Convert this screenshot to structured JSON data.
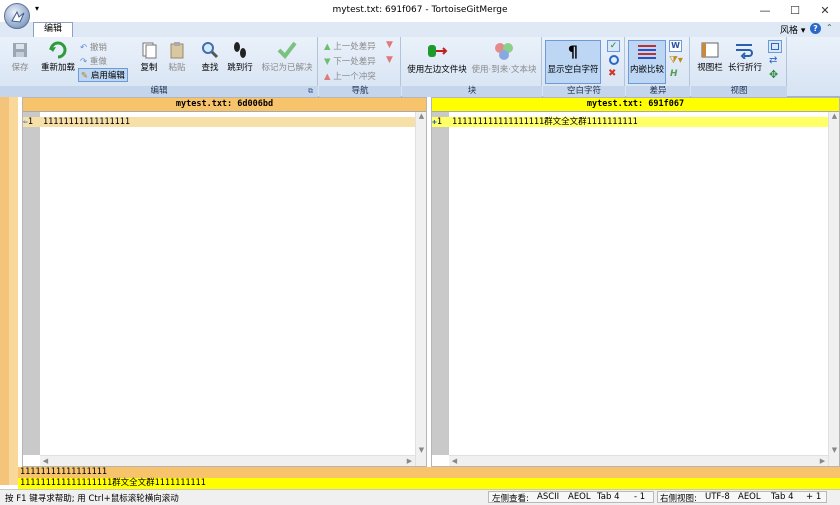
{
  "window": {
    "title": "mytest.txt: 691f067 - TortoiseGitMerge",
    "qat_glyph": "▾",
    "min": "—",
    "max": "☐",
    "close": "✕"
  },
  "ribbon": {
    "tabs": [
      {
        "label": "编辑"
      }
    ],
    "style_menu": "风格 ▾",
    "help": "?",
    "minimize_glyph": "⌃",
    "groups": {
      "edit": {
        "label": "编辑",
        "save": "保存",
        "reload": "重新加载",
        "undo": "撤销",
        "redo": "重做",
        "enable_edit": "启用编辑",
        "copy": "复制",
        "paste": "粘贴",
        "find": "查找",
        "goto_line": "跳到行",
        "mark_resolved": "标记为已解决"
      },
      "nav": {
        "label": "导航",
        "prev_diff": "上一处差异",
        "next_diff": "下一处差异",
        "prev_conflict": "上一个冲突"
      },
      "block": {
        "label": "块",
        "use_left_file": "使用左边文件块",
        "use_to_text": "使用·到来·文本块"
      },
      "whitespace": {
        "label": "空白字符",
        "show_ws": "显示空白字符"
      },
      "diff": {
        "label": "差异",
        "inline_diff": "内嵌比较"
      },
      "view": {
        "label": "视图",
        "view_bar": "视图栏",
        "wrap_lines": "长行折行"
      }
    }
  },
  "panes": {
    "left": {
      "header": "mytest.txt: 6d006bd",
      "line_no": "1",
      "line_text": "11111111111111111",
      "marker": "⇐"
    },
    "right": {
      "header": "mytest.txt: 691f067",
      "line_no": "1",
      "line_text": "111111111111111111群文全文群1111111111",
      "marker": "✚"
    }
  },
  "bottom_diff": {
    "line1": "11111111111111111",
    "line2": "111111111111111111群文全文群1111111111"
  },
  "status": {
    "help_text": "按 F1 键寻求帮助; 用 Ctrl+鼠标滚轮横向滚动",
    "left_label": "左侧查看:",
    "left_enc": "ASCII",
    "left_eol": "AEOL",
    "left_tab": "Tab 4",
    "left_delta": "- 1",
    "right_label": "右侧视图:",
    "right_enc": "UTF-8",
    "right_eol": "AEOL",
    "right_tab": "Tab 4",
    "right_delta": "+ 1"
  },
  "colors": {
    "left_header": "#f7c46c",
    "right_header": "#ffff00",
    "ribbon_bg": "#dfe9f5",
    "accent": "#2a67c7"
  }
}
